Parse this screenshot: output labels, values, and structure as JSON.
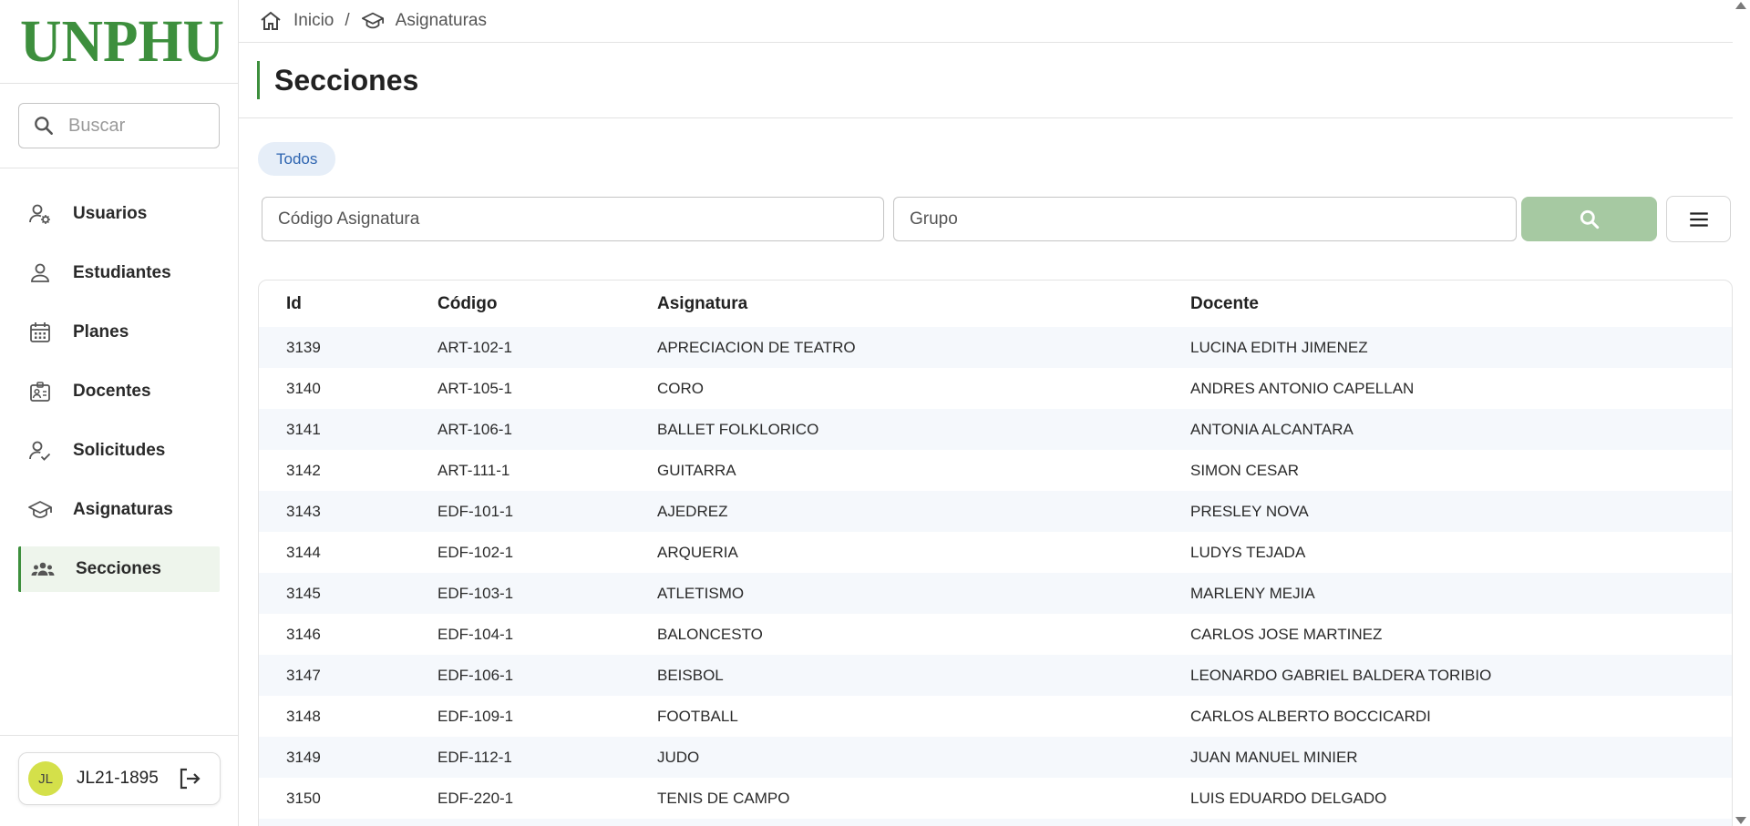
{
  "app": {
    "logo_text": "UNPHU",
    "brand_color": "#3d8f3d"
  },
  "sidebar": {
    "search": {
      "placeholder": "Buscar",
      "value": ""
    },
    "items": [
      {
        "label": "Usuarios",
        "icon": "user-gear-icon",
        "active": false
      },
      {
        "label": "Estudiantes",
        "icon": "person-icon",
        "active": false
      },
      {
        "label": "Planes",
        "icon": "calendar-icon",
        "active": false
      },
      {
        "label": "Docentes",
        "icon": "id-badge-icon",
        "active": false
      },
      {
        "label": "Solicitudes",
        "icon": "user-check-icon",
        "active": false
      },
      {
        "label": "Asignaturas",
        "icon": "graduation-cap-icon",
        "active": false
      },
      {
        "label": "Secciones",
        "icon": "group-icon",
        "active": true
      }
    ],
    "user": {
      "initials": "JL",
      "username": "JL21-1895",
      "avatar_color": "#d4e04a"
    }
  },
  "breadcrumb": {
    "home": "Inicio",
    "separator": "/",
    "current": "Asignaturas"
  },
  "page": {
    "title": "Secciones"
  },
  "chips": {
    "all": "Todos"
  },
  "filters": {
    "codigo_placeholder": "Código Asignatura",
    "grupo_placeholder": "Grupo"
  },
  "table": {
    "headers": {
      "id": "Id",
      "codigo": "Código",
      "asignatura": "Asignatura",
      "docente": "Docente"
    },
    "rows": [
      {
        "id": "3139",
        "codigo": "ART-102-1",
        "asignatura": "APRECIACION DE TEATRO",
        "docente": "LUCINA EDITH JIMENEZ"
      },
      {
        "id": "3140",
        "codigo": "ART-105-1",
        "asignatura": "CORO",
        "docente": "ANDRES ANTONIO CAPELLAN"
      },
      {
        "id": "3141",
        "codigo": "ART-106-1",
        "asignatura": "BALLET FOLKLORICO",
        "docente": "ANTONIA ALCANTARA"
      },
      {
        "id": "3142",
        "codigo": "ART-111-1",
        "asignatura": "GUITARRA",
        "docente": "SIMON CESAR"
      },
      {
        "id": "3143",
        "codigo": "EDF-101-1",
        "asignatura": "AJEDREZ",
        "docente": "PRESLEY NOVA"
      },
      {
        "id": "3144",
        "codigo": "EDF-102-1",
        "asignatura": "ARQUERIA",
        "docente": "LUDYS TEJADA"
      },
      {
        "id": "3145",
        "codigo": "EDF-103-1",
        "asignatura": "ATLETISMO",
        "docente": "MARLENY MEJIA"
      },
      {
        "id": "3146",
        "codigo": "EDF-104-1",
        "asignatura": "BALONCESTO",
        "docente": "CARLOS JOSE MARTINEZ"
      },
      {
        "id": "3147",
        "codigo": "EDF-106-1",
        "asignatura": "BEISBOL",
        "docente": "LEONARDO GABRIEL BALDERA TORIBIO"
      },
      {
        "id": "3148",
        "codigo": "EDF-109-1",
        "asignatura": "FOOTBALL",
        "docente": "CARLOS ALBERTO BOCCICARDI"
      },
      {
        "id": "3149",
        "codigo": "EDF-112-1",
        "asignatura": "JUDO",
        "docente": "JUAN MANUEL MINIER"
      },
      {
        "id": "3150",
        "codigo": "EDF-220-1",
        "asignatura": "TENIS DE CAMPO",
        "docente": "LUIS EDUARDO DELGADO"
      },
      {
        "id": "",
        "codigo": "",
        "asignatura": "",
        "docente": ""
      }
    ]
  }
}
